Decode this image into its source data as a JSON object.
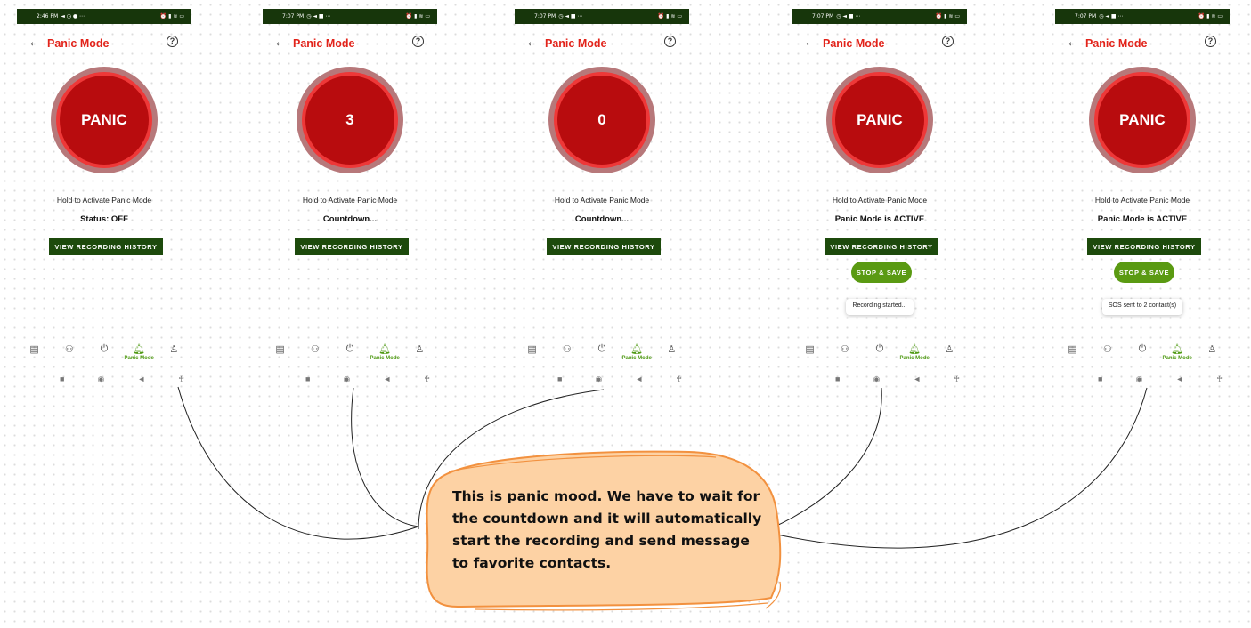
{
  "screens": [
    {
      "status_time": "2:46 PM",
      "status_left_icons": "◄ ◷ ● ⋯",
      "status_right_icons": "⏰ ▮ ≋ ▭",
      "title": "Panic Mode",
      "panic_label": "PANIC",
      "hold_text": "Hold to Activate Panic Mode",
      "status_text": "Status: OFF",
      "history_button": "VIEW RECORDING HISTORY",
      "nav_active_label": "Panic Mode"
    },
    {
      "status_time": "7:07 PM",
      "status_left_icons": "◷ ◄ ■ ⋯",
      "status_right_icons": "⏰ ▮ ≋ ▭",
      "title": "Panic Mode",
      "panic_label": "3",
      "hold_text": "Hold to Activate Panic Mode",
      "status_text": "Countdown...",
      "history_button": "VIEW RECORDING HISTORY",
      "nav_active_label": "Panic Mode"
    },
    {
      "status_time": "7:07 PM",
      "status_left_icons": "◷ ◄ ■ ⋯",
      "status_right_icons": "⏰ ▮ ≋ ▭",
      "title": "Panic Mode",
      "panic_label": "0",
      "hold_text": "Hold to Activate Panic Mode",
      "status_text": "Countdown...",
      "history_button": "VIEW RECORDING HISTORY",
      "nav_active_label": "Panic Mode"
    },
    {
      "status_time": "7:07 PM",
      "status_left_icons": "◷ ◄ ■ ⋯",
      "status_right_icons": "⏰ ▮ ≋ ▭",
      "title": "Panic Mode",
      "panic_label": "PANIC",
      "hold_text": "Hold to Activate Panic Mode",
      "status_text": "Panic Mode is ACTIVE",
      "history_button": "VIEW RECORDING HISTORY",
      "stop_button": "STOP & SAVE",
      "toast": "Recording started...",
      "nav_active_label": "Panic Mode"
    },
    {
      "status_time": "7:07 PM",
      "status_left_icons": "◷ ◄ ■ ⋯",
      "status_right_icons": "⏰ ▮ ≋ ▭",
      "title": "Panic Mode",
      "panic_label": "PANIC",
      "hold_text": "Hold to Activate Panic Mode",
      "status_text": "Panic Mode is ACTIVE",
      "history_button": "VIEW RECORDING HISTORY",
      "stop_button": "STOP & SAVE",
      "toast": "SOS sent to 2 contact(s)",
      "nav_active_label": "Panic Mode"
    }
  ],
  "icons": {
    "back": "arrow-left-icon",
    "help": "help-circle-icon",
    "nav": [
      "chat-icon",
      "contacts-icon",
      "power-icon",
      "bell-icon",
      "profile-icon"
    ],
    "system_nav": [
      "recents-square-icon",
      "home-circle-icon",
      "back-triangle-icon",
      "accessibility-icon"
    ]
  },
  "callout": {
    "text": "This is panic mood. We have to wait for the countdown and it will automatically start the recording and send message to favorite contacts."
  },
  "colors": {
    "status_bar": "#17360b",
    "title_red": "#e2231a",
    "panic_dark": "#b80c0e",
    "panic_ring": "#ee3838",
    "panic_outer": "#b7787a",
    "history_button": "#1d4a0c",
    "stop_button": "#5a9a12",
    "active_nav": "#4f9a13",
    "callout_fill": "#fdd2a4",
    "callout_stroke": "#f2913f"
  }
}
